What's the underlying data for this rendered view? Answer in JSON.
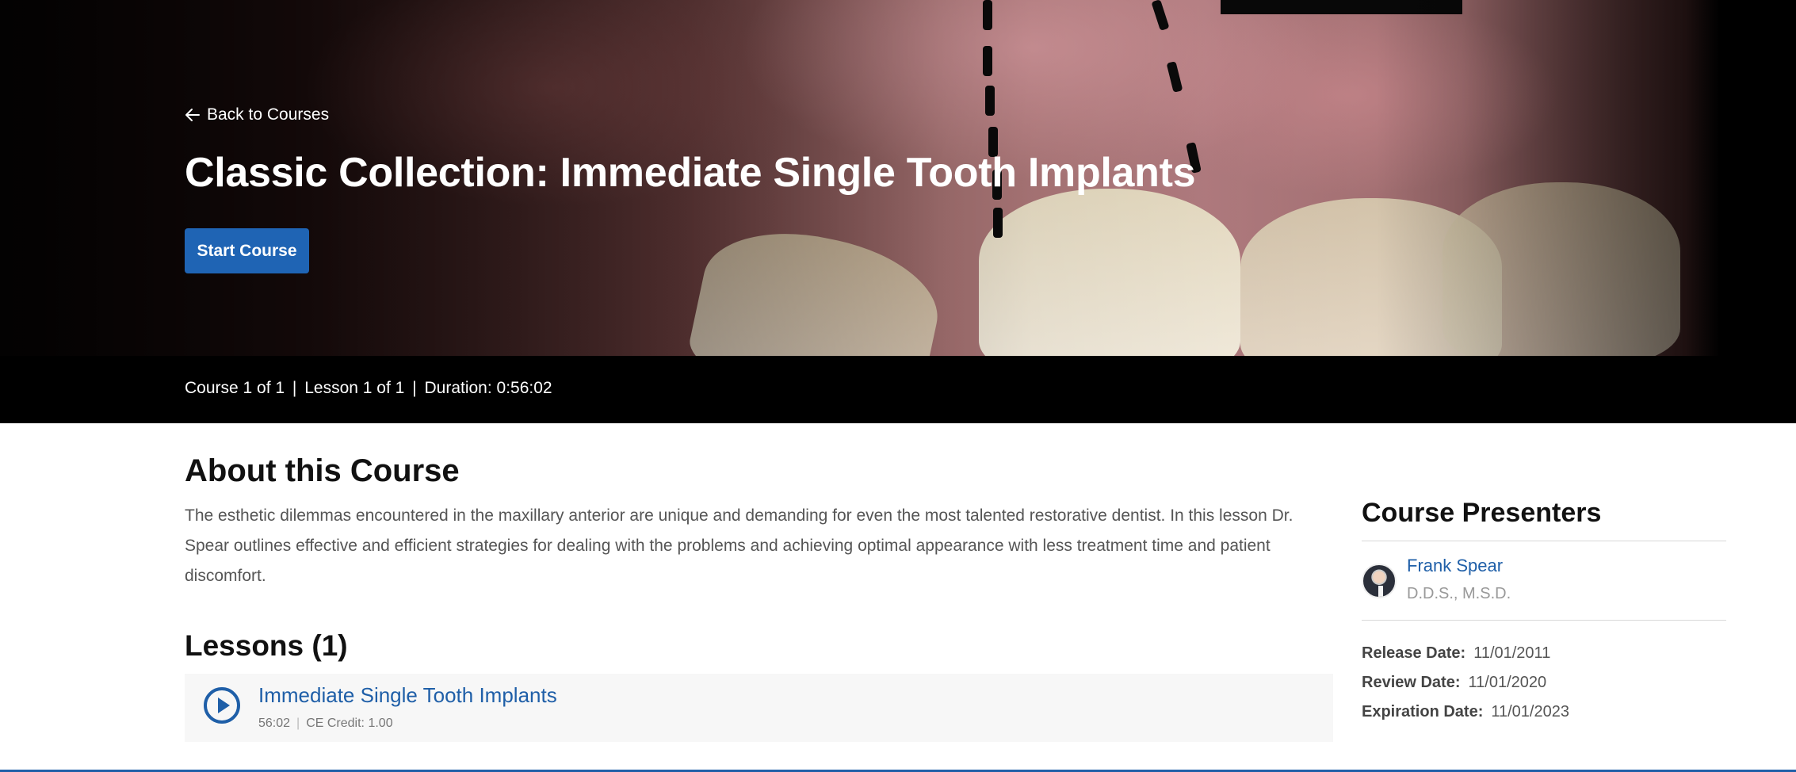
{
  "hero": {
    "back_label": "Back to Courses",
    "title": "Classic Collection: Immediate Single Tooth Implants",
    "start_button": "Start Course",
    "meta": {
      "course": "Course 1 of 1",
      "lesson": "Lesson 1 of 1",
      "duration": "Duration: 0:56:02",
      "separator": "|"
    }
  },
  "about": {
    "heading": "About this Course",
    "text": "The esthetic dilemmas encountered in the maxillary anterior are unique and demanding for even the most talented restorative dentist. In this lesson Dr. Spear outlines effective and efficient strategies for dealing with the problems and achieving optimal appearance with less treatment time and patient discomfort."
  },
  "lessons": {
    "heading": "Lessons (1)",
    "items": [
      {
        "title": "Immediate Single Tooth Implants",
        "duration": "56:02",
        "ce_credit": "CE Credit: 1.00",
        "separator": "|"
      }
    ]
  },
  "sidebar": {
    "heading": "Course Presenters",
    "presenter": {
      "name": "Frank Spear",
      "credentials": "D.D.S., M.S.D."
    },
    "dates": [
      {
        "label": "Release Date:",
        "value": "11/01/2011"
      },
      {
        "label": "Review Date:",
        "value": "11/01/2020"
      },
      {
        "label": "Expiration Date:",
        "value": "11/01/2023"
      }
    ]
  },
  "colors": {
    "brand_blue": "#1f64b4",
    "link_blue": "#1f5fa8"
  }
}
